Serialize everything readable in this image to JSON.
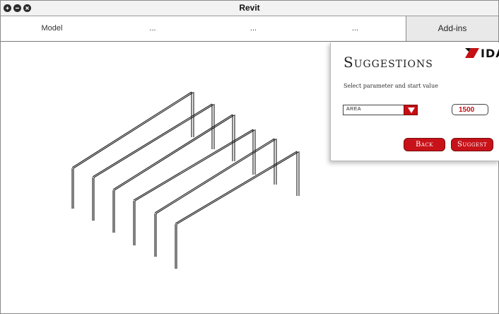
{
  "window": {
    "title": "Revit"
  },
  "ribbon": {
    "tabs": [
      {
        "label": "Model"
      },
      {
        "label": "..."
      },
      {
        "label": "..."
      },
      {
        "label": "..."
      },
      {
        "label": "Add-ins"
      }
    ]
  },
  "panel": {
    "title": "Suggestions",
    "logo_text": "IDA",
    "instruction": "Select parameter and start value",
    "parameter": {
      "selected": "AREA"
    },
    "start_value": "1500",
    "back_label": "Back",
    "suggest_label": "Suggest"
  },
  "colors": {
    "accent": "#c8121a"
  },
  "icons": {
    "close": "close-icon",
    "minimize": "minimize-icon",
    "maximize": "maximize-icon",
    "dropdown": "triangle-down-icon"
  }
}
